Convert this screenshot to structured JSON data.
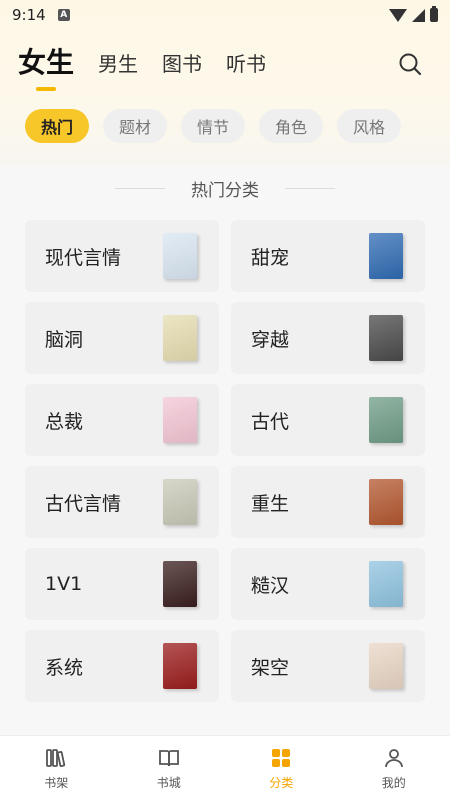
{
  "status_bar": {
    "time": "9:14",
    "notification_icon": "A"
  },
  "top_tabs": [
    {
      "label": "女生",
      "active": true
    },
    {
      "label": "男生",
      "active": false
    },
    {
      "label": "图书",
      "active": false
    },
    {
      "label": "听书",
      "active": false
    }
  ],
  "filter_chips": [
    {
      "label": "热门",
      "active": true
    },
    {
      "label": "题材",
      "active": false
    },
    {
      "label": "情节",
      "active": false
    },
    {
      "label": "角色",
      "active": false
    },
    {
      "label": "风格",
      "active": false
    }
  ],
  "section": {
    "title": "热门分类"
  },
  "categories": [
    {
      "label": "现代言情",
      "cover_color": "#d9e6f2"
    },
    {
      "label": "甜宠",
      "cover_color": "#2f6bb3"
    },
    {
      "label": "脑洞",
      "cover_color": "#e6ddb0"
    },
    {
      "label": "穿越",
      "cover_color": "#4a4a4a"
    },
    {
      "label": "总裁",
      "cover_color": "#f3c6d4"
    },
    {
      "label": "古代",
      "cover_color": "#6f9c86"
    },
    {
      "label": "古代言情",
      "cover_color": "#c9c9b8"
    },
    {
      "label": "重生",
      "cover_color": "#b3572e"
    },
    {
      "label": "1V1",
      "cover_color": "#3a1e1e"
    },
    {
      "label": "糙汉",
      "cover_color": "#8fc3e0"
    },
    {
      "label": "系统",
      "cover_color": "#9b1c1c"
    },
    {
      "label": "架空",
      "cover_color": "#e9d6c5"
    }
  ],
  "bottom_nav": [
    {
      "label": "书架",
      "icon": "bookshelf-icon",
      "active": false
    },
    {
      "label": "书城",
      "icon": "book-icon",
      "active": false
    },
    {
      "label": "分类",
      "icon": "category-icon",
      "active": true
    },
    {
      "label": "我的",
      "icon": "profile-icon",
      "active": false
    }
  ],
  "colors": {
    "accent": "#f7c72a",
    "accent_text": "#f5a500"
  }
}
